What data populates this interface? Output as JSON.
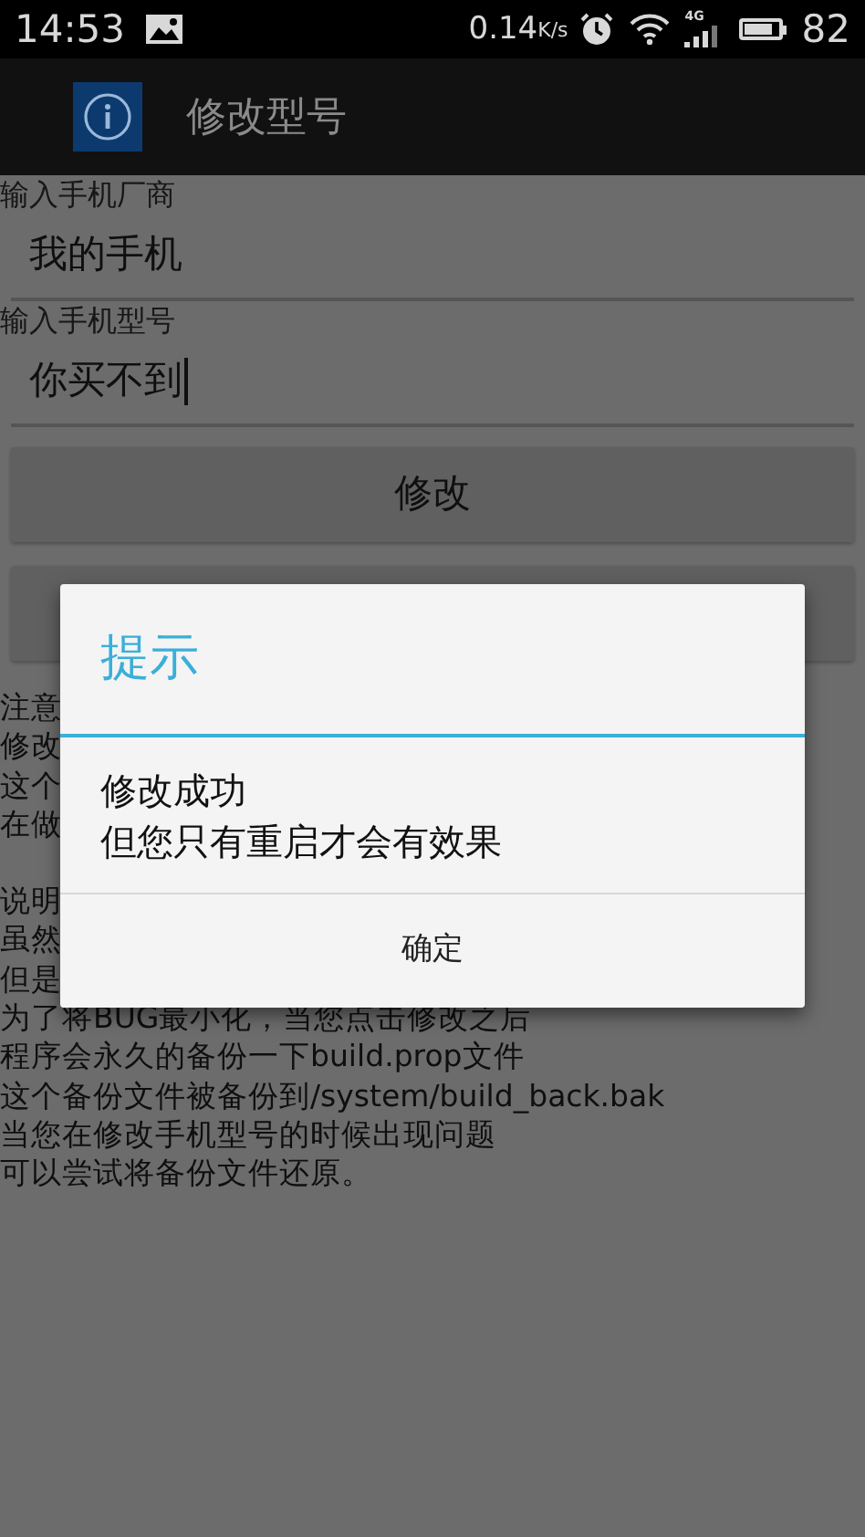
{
  "status_bar": {
    "time": "14:53",
    "speed": "0.14",
    "speed_unit": "K/s",
    "network": "4G",
    "battery": "82"
  },
  "action_bar": {
    "title": "修改型号"
  },
  "fields": [
    {
      "label": "输入手机厂商",
      "value": "我的手机",
      "focused": false
    },
    {
      "label": "输入手机型号",
      "value": "你买不到",
      "focused": true
    }
  ],
  "buttons": [
    "修改"
  ],
  "notes": [
    {
      "lines": [
        "注意",
        "修改",
        "这个",
        "在做"
      ]
    },
    {
      "lines": [
        "说明",
        "虽然",
        "但是",
        "为了将BUG最小化，当您点击修改之后",
        "程序会永久的备份一下build.prop文件",
        "这个备份文件被备份到/system/build_back.bak",
        "当您在修改手机型号的时候出现问题",
        "可以尝试将备份文件还原。"
      ]
    }
  ],
  "dialog": {
    "title": "提示",
    "message_lines": [
      "修改成功",
      "但您只有重启才会有效果"
    ],
    "button": "确定"
  }
}
